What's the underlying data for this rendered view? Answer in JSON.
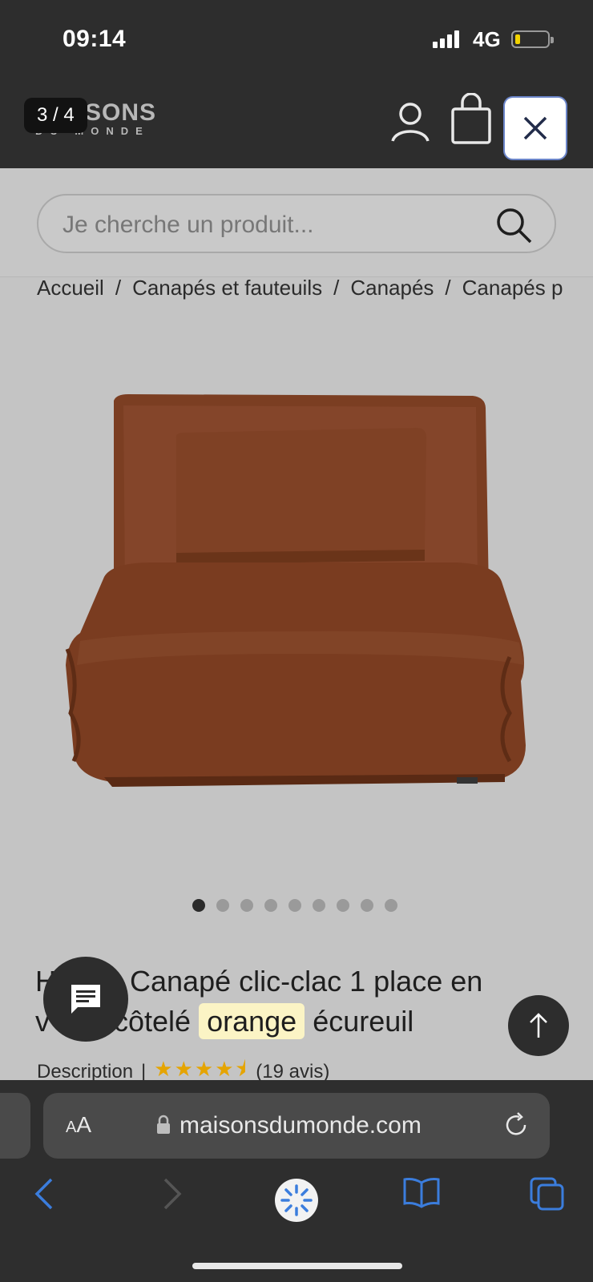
{
  "status": {
    "time": "09:14",
    "network": "4G",
    "battery_level": 0.1,
    "battery_color": "#f2d300"
  },
  "header": {
    "logo_line1": "SONS",
    "logo_line2": "DU MONDE",
    "pager": "3 / 4",
    "icons": [
      "user-icon",
      "shopping-bag-icon",
      "close-icon"
    ]
  },
  "search": {
    "placeholder": "Je cherche un produit..."
  },
  "breadcrumb": [
    "Accueil",
    "Canapés et fauteuils",
    "Canapés",
    "Canapés p"
  ],
  "carousel": {
    "dots": 9,
    "active_index": 0
  },
  "product": {
    "title_part1": "H    n - Canapé clic-clac 1 place en",
    "title_part2_a": "v    rs côtelé ",
    "title_highlight": "orange",
    "title_part2_b": " écureuil",
    "description_link": "Description",
    "separator": "|",
    "rating": 4.5,
    "stars": "★★★★⯨",
    "reviews": "(19 avis)",
    "sofa_color": "#7b3e22"
  },
  "browser": {
    "aa_label_small": "A",
    "aa_label_large": "A",
    "url": "maisonsdumonde.com"
  }
}
